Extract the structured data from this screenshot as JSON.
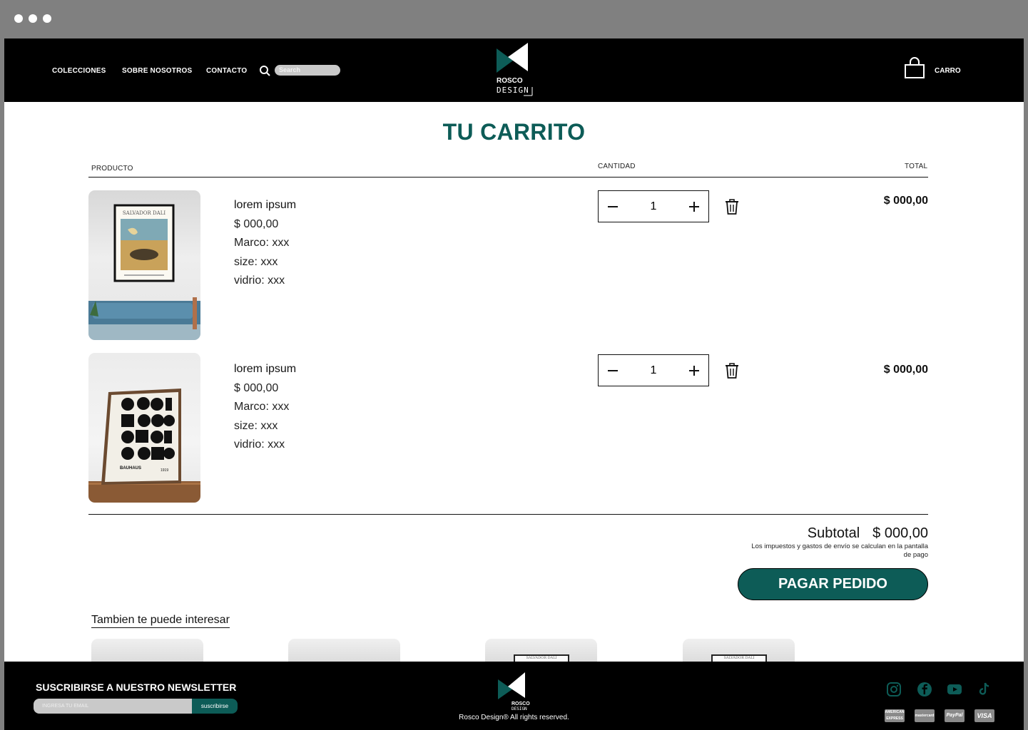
{
  "header": {
    "nav": [
      "COLECCIONES",
      "SOBRE NOSOTROS",
      "CONTACTO"
    ],
    "search_placeholder": "Search",
    "logo_text_1": "ROSCO",
    "logo_text_2": "DESIGN",
    "cart_label": "CARRO"
  },
  "cart": {
    "title": "TU CARRITO",
    "columns": {
      "product": "PRODUCTO",
      "quantity": "CANTIDAD",
      "total": "TOTAL"
    },
    "items": [
      {
        "name": "lorem ipsum",
        "price": "$ 000,00",
        "marco": "Marco: xxx",
        "size": "size: xxx",
        "vidrio": "vidrio: xxx",
        "qty": "1",
        "total": "$ 000,00",
        "poster_title": "SALVADOR DALI"
      },
      {
        "name": "lorem ipsum",
        "price": "$ 000,00",
        "marco": "Marco: xxx",
        "size": "size: xxx",
        "vidrio": "vidrio: xxx",
        "qty": "1",
        "total": "$ 000,00",
        "poster_title": "BAUHAUS",
        "poster_year": "1919"
      }
    ],
    "subtotal_label": "Subtotal",
    "subtotal_value": "$ 000,00",
    "tax_note": "Los impuestos y gastos de envío se calculan en la pantalla de pago",
    "pay_button": "PAGAR PEDIDO"
  },
  "recommendations": {
    "title": "Tambien te puede interesar",
    "items": [
      {
        "poster_title": ""
      },
      {
        "poster_title": ""
      },
      {
        "poster_title": "SALVADOR DALI"
      },
      {
        "poster_title": "SALVADOR DALI"
      }
    ]
  },
  "footer": {
    "newsletter_title": "SUSCRIBIRSE A NUESTRO NEWSLETTER",
    "email_placeholder": "INGRESA TU EMAIL",
    "subscribe_button": "suscribirse",
    "rights": "Rosco Design® All rights reserved.",
    "social": [
      "instagram-icon",
      "facebook-icon",
      "youtube-icon",
      "tiktok-icon"
    ],
    "payments": [
      "AMERICAN EXPRESS",
      "mastercard",
      "PayPal",
      "VISA"
    ]
  },
  "colors": {
    "brand": "#0d5c57",
    "header_bg": "#000000"
  }
}
